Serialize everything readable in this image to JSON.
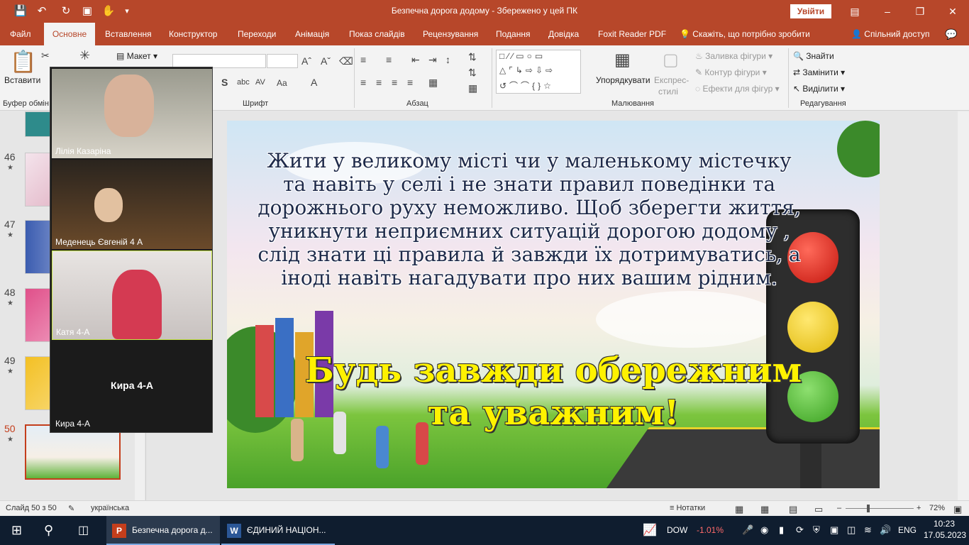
{
  "window": {
    "title": "Безпечна дорога додому  -  Збережено у цей ПК",
    "signin": "Увійти"
  },
  "tabs": [
    {
      "label": "Файл"
    },
    {
      "label": "Основне"
    },
    {
      "label": "Вставлення"
    },
    {
      "label": "Конструктор"
    },
    {
      "label": "Переходи"
    },
    {
      "label": "Анімація"
    },
    {
      "label": "Показ слайдів"
    },
    {
      "label": "Рецензування"
    },
    {
      "label": "Подання"
    },
    {
      "label": "Довідка"
    },
    {
      "label": "Foxit Reader PDF"
    }
  ],
  "tell_me": "Скажіть, що потрібно зробити",
  "share": "Спільний доступ",
  "ribbon": {
    "paste": "Вставити",
    "clipboard": "Буфер обмін",
    "layout": "Макет",
    "font_group": "Шрифт",
    "paragraph_group": "Абзац",
    "arrange": "Упорядкувати",
    "quick_styles_1": "Експрес-",
    "quick_styles_2": "стилі",
    "shape_fill": "Заливка фігури",
    "shape_outline": "Контур фігури",
    "shape_effects": "Ефекти для фігур",
    "drawing_group": "Малювання",
    "find": "Знайти",
    "replace": "Замінити",
    "select": "Виділити",
    "editing_group": "Редагування"
  },
  "thumbnails": [
    {
      "num": "46"
    },
    {
      "num": "47"
    },
    {
      "num": "48"
    },
    {
      "num": "49"
    },
    {
      "num": "50"
    }
  ],
  "slide": {
    "body": "Жити у великому місті чи у маленькому містечку та навіть у селі і не знати правил поведінки та дорожнього руху неможливо. Щоб зберегти життя, уникнути неприємних ситуацій дорогою додому , слід знати ці правила й завжди їх дотримуватись, а іноді навіть нагадувати про них вашим рідним.",
    "call_line1": "Будь завжди обережним",
    "call_line2": "та уважним!"
  },
  "participants": [
    {
      "name": "Лілія Казаріна"
    },
    {
      "name": "Меденець Євгеній 4 А"
    },
    {
      "name": "Катя  4-А"
    },
    {
      "name": "Кира 4-А",
      "placeholder": "Кира 4-А"
    }
  ],
  "status": {
    "slide_count": "Слайд 50 з 50",
    "language": "українська",
    "notes": "Нотатки",
    "zoom": "72%"
  },
  "taskbar": {
    "app1": "Безпечна дорога д...",
    "app2": "ЄДИНИЙ НАЦІОН...",
    "ticker": "DOW",
    "ticker_change": "-1.01%",
    "lang": "ENG",
    "time": "10:23",
    "date": "17.05.2023"
  },
  "colors": {
    "accent": "#b7472a",
    "taskbar": "#0f1d2f",
    "call_text": "#fff200"
  }
}
